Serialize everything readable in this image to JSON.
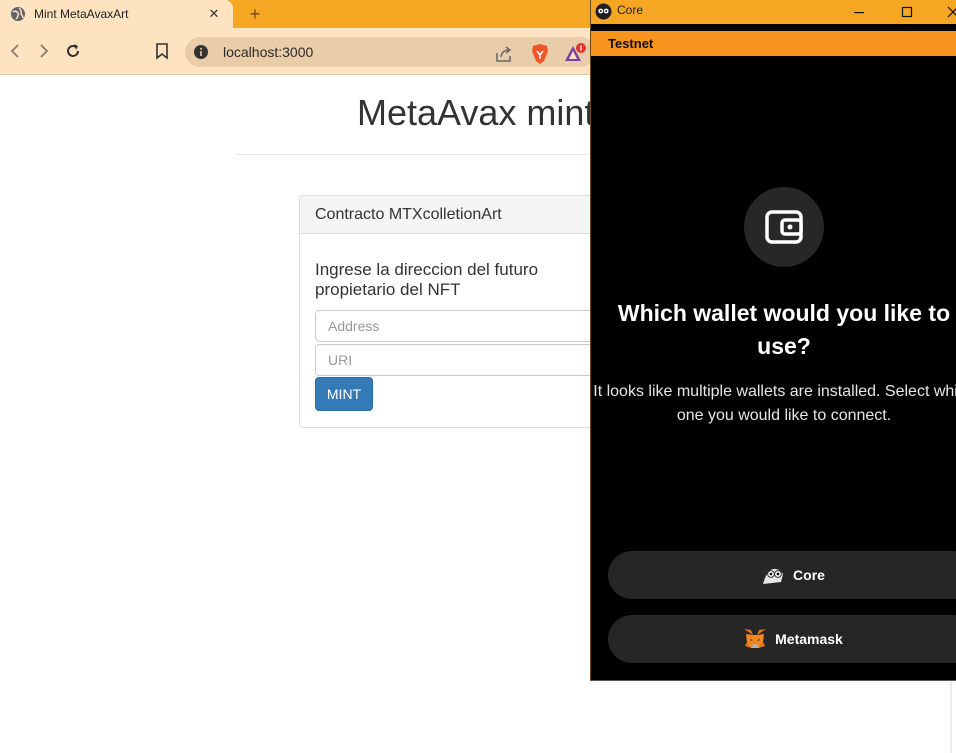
{
  "browser": {
    "tab_title": "Mint MetaAvaxArt",
    "tab_close": "✕",
    "new_tab": "+",
    "url": "localhost:3000"
  },
  "page": {
    "title": "MetaAvax mint",
    "panel_heading": "Contracto MTXcolletionArt",
    "prompt": "Ingrese la direccion del futuro propietario del NFT",
    "address_placeholder": "Address",
    "uri_placeholder": "URI",
    "mint_label": "MINT"
  },
  "wallet_window": {
    "title": "Core",
    "network": "Testnet",
    "heading": "Which wallet would you like to use?",
    "subtitle": "It looks like multiple wallets are installed. Select which one you would like to connect.",
    "options": [
      {
        "label": "Core",
        "icon": "core-owl-icon"
      },
      {
        "label": "Metamask",
        "icon": "metamask-fox-icon"
      }
    ]
  },
  "colors": {
    "chrome_orange": "#f5a623",
    "network_bar": "#f7941d",
    "mint_button": "#337ab7",
    "wallet_bg": "#000000",
    "option_bg": "#262626"
  }
}
